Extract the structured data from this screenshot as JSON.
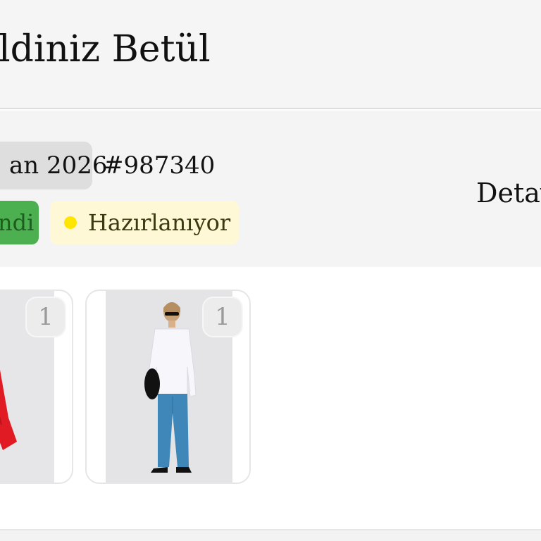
{
  "header": {
    "welcome_text": "ldiniz Betül"
  },
  "order": {
    "date": "an 2026",
    "number": "#987340",
    "detail_link": "Detay",
    "status_primary": "ndi",
    "status_secondary": "Hazırlanıyor"
  },
  "products": [
    {
      "quantity": "1",
      "image": "red-shirt-product-photo"
    },
    {
      "quantity": "1",
      "image": "model-white-shirt-blue-jeans-photo"
    }
  ],
  "colors": {
    "status_green": "#4caf50",
    "status_yellow_bg": "#fff8d6",
    "status_dot": "#ffe600",
    "header_bg": "#f5f5f5"
  }
}
